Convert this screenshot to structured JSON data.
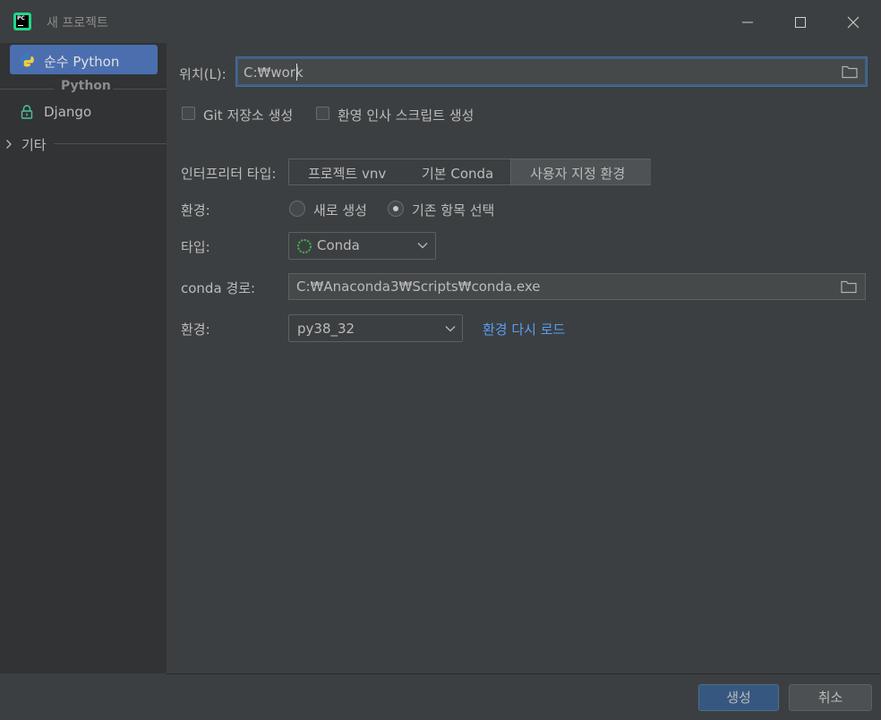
{
  "window": {
    "title": "새 프로젝트",
    "app_icon_text": "PC"
  },
  "sidebar": {
    "selected": {
      "label": "순수 Python"
    },
    "group_label": "Python",
    "items": [
      {
        "label": "Django"
      }
    ],
    "other_group": {
      "label": "기타"
    }
  },
  "location": {
    "label": "위치(L):",
    "value": "C:₩work"
  },
  "options": {
    "git_repo": {
      "label": "Git 저장소 생성",
      "checked": false
    },
    "welcome_script": {
      "label": "환영 인사 스크립트 생성",
      "checked": false
    }
  },
  "interpreter": {
    "label": "인터프리터 타입:",
    "tabs": [
      {
        "label": "프로젝트 vnv",
        "selected": false
      },
      {
        "label": "기본 Conda",
        "selected": false
      },
      {
        "label": "사용자 지정 환경",
        "selected": true
      }
    ]
  },
  "environment": {
    "label": "환경:",
    "radios": [
      {
        "label": "새로 생성",
        "selected": false
      },
      {
        "label": "기존 항목 선택",
        "selected": true
      }
    ]
  },
  "type": {
    "label": "타입:",
    "value": "Conda"
  },
  "conda_path": {
    "label": "conda 경로:",
    "value": "C:₩Anaconda3₩Scripts₩conda.exe"
  },
  "env_select": {
    "label": "환경:",
    "value": "py38_32",
    "reload_link": "환경 다시 로드"
  },
  "footer": {
    "create_label": "생성",
    "cancel_label": "취소"
  },
  "colors": {
    "accent": "#4b6eaf",
    "link": "#589df6",
    "background": "#3c3f41",
    "sidebar": "#313335"
  }
}
